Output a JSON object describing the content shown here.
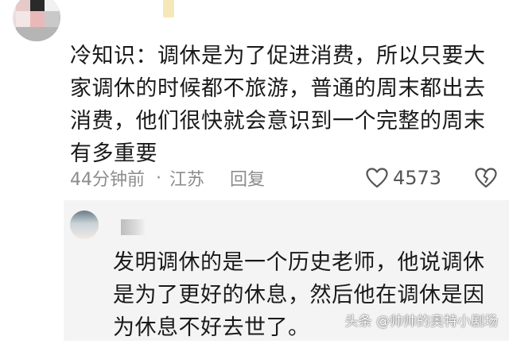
{
  "comment": {
    "text": "冷知识：调休是为了促进消费，所以只要大家调休的时候都不旅游，普通的周末都出去消费，他们很快就会意识到一个完整的周末有多重要",
    "time": "44分钟前",
    "separator": "·",
    "location": "江苏",
    "reply_label": "回复",
    "like_count": "4573",
    "like_icon": "heart-outline-icon",
    "dislike_icon": "broken-heart-icon"
  },
  "reply": {
    "text": "发明调休的是一个历史老师，他说调休是为了更好的休息，然后他在调休是因为休息不好去世了。"
  },
  "watermark": "头条 @帅帅的奥特小剧场",
  "colors": {
    "meta_gray": "#8c8c8c",
    "reply_background": "#f4f4f4"
  }
}
